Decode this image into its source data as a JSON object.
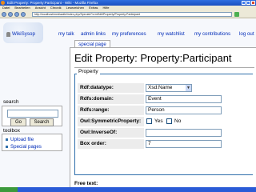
{
  "window": {
    "title": "Edit Property: Property:Participant - Wiki - Mozilla Firefox"
  },
  "menu": [
    "Datei",
    "Bearbeiten",
    "Ansicht",
    "Chronik",
    "Lesezeichen",
    "Extras",
    "Hilfe"
  ],
  "urlbar": {
    "url": "http://localhost/mediawiki/index.php/Special:FormEdit/Property/Property:Participant"
  },
  "personal": {
    "username": "WikiSysop",
    "my_talk": "my talk",
    "admin_links": "admin links",
    "preferences": "my preferences",
    "watchlist": "my watchlist",
    "contributions": "my contributions",
    "logout": "log out"
  },
  "tab": {
    "label": "special page"
  },
  "page": {
    "title": "Edit Property: Property:Participant"
  },
  "form": {
    "legend": "Property",
    "rows": {
      "datatype": {
        "label": "Rdf:datatype:",
        "value": "Xsd:Name"
      },
      "domain": {
        "label": "Rdfs:domain:",
        "value": "Event"
      },
      "range": {
        "label": "Rdfs:range:",
        "value": "Person"
      },
      "symmetric": {
        "label": "Owl:SymmetricProperty:",
        "yes": "Yes",
        "no": "No"
      },
      "inverse": {
        "label": "Owl:InverseOf:",
        "value": ""
      },
      "box_order": {
        "label": "Box order:",
        "value": "7"
      }
    },
    "free_text_label": "Free text:"
  },
  "sidebar": {
    "search_title": "search",
    "go_label": "Go",
    "search_label": "Search",
    "toolbox_title": "toolbox",
    "toolbox_items": [
      "Upload file",
      "Special pages"
    ]
  }
}
